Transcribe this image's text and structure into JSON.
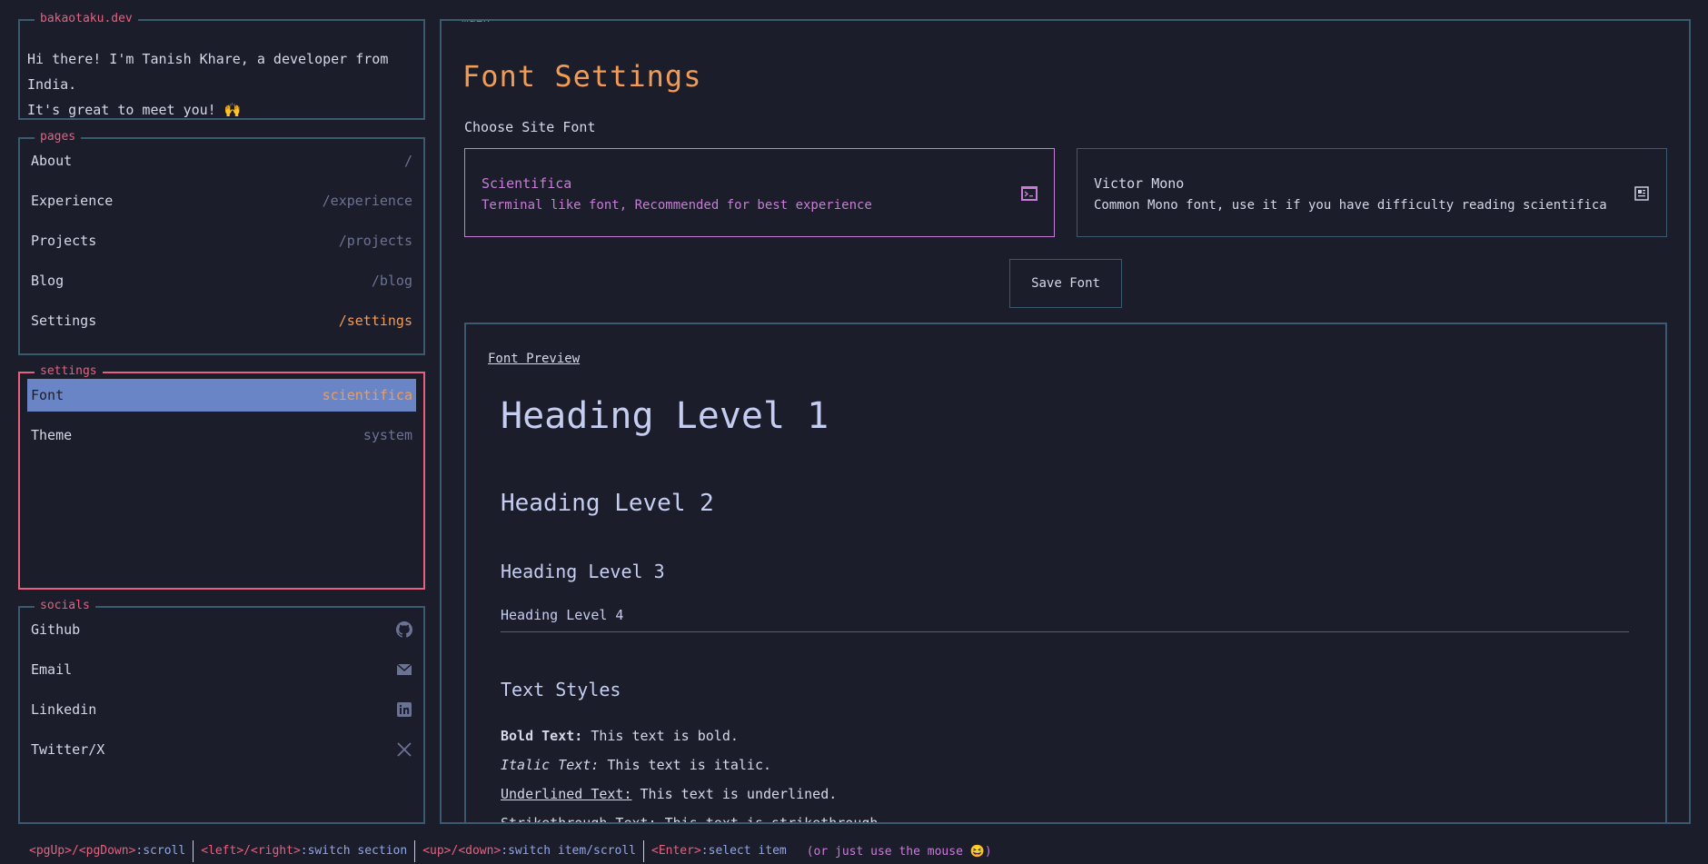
{
  "intro": {
    "title": "bakaotaku.dev",
    "line1": "Hi there! I'm Tanish Khare, a developer from India.",
    "line2": "It's great to meet you! 🙌"
  },
  "pages": {
    "title": "pages",
    "items": [
      {
        "label": "About",
        "path": "/"
      },
      {
        "label": "Experience",
        "path": "/experience"
      },
      {
        "label": "Projects",
        "path": "/projects"
      },
      {
        "label": "Blog",
        "path": "/blog"
      },
      {
        "label": "Settings",
        "path": "/settings"
      }
    ]
  },
  "settings": {
    "title": "settings",
    "items": [
      {
        "label": "Font",
        "value": "scientifica"
      },
      {
        "label": "Theme",
        "value": "system"
      }
    ]
  },
  "socials": {
    "title": "socials",
    "items": [
      {
        "label": "Github",
        "icon": "github-icon"
      },
      {
        "label": "Email",
        "icon": "email-icon"
      },
      {
        "label": "Linkedin",
        "icon": "linkedin-icon"
      },
      {
        "label": "Twitter/X",
        "icon": "x-icon"
      }
    ]
  },
  "main": {
    "panel_title": "main",
    "title": "Font Settings",
    "choose_label": "Choose Site Font",
    "fonts": [
      {
        "name": "Scientifica",
        "desc": "Terminal like font, Recommended for best experience",
        "icon": "terminal-icon"
      },
      {
        "name": "Victor Mono",
        "desc": "Common Mono font, use it if you have difficulty reading scientifica",
        "icon": "document-icon"
      }
    ],
    "save_label": "Save Font",
    "preview": {
      "label": "Font Preview",
      "h1": "Heading Level 1",
      "h2": "Heading Level 2",
      "h3": "Heading Level 3",
      "h4": "Heading Level 4",
      "styles_heading": "Text Styles",
      "bold_key": "Bold Text:",
      "bold_val": " This text is bold.",
      "italic_key": "Italic Text:",
      "italic_val": " This text is italic.",
      "underline_key": "Underlined Text:",
      "underline_val": " This text is underlined.",
      "strike_key": "Strikethrough Text:",
      "strike_val": " This text is strikethrough."
    }
  },
  "footer": {
    "hints": [
      {
        "key": "<pgUp>/<pgDown>",
        "desc": ":scroll"
      },
      {
        "key": "<left>/<right>",
        "desc": ":switch section"
      },
      {
        "key": "<up>/<down>",
        "desc": ":switch item/scroll"
      },
      {
        "key": "<Enter>",
        "desc": ":select item"
      }
    ],
    "note": "(or just use the mouse 😆)"
  },
  "colors": {
    "background": "#1c1d2b",
    "border": "#3a5a6f",
    "accent_pink": "#e8607d",
    "accent_orange": "#f29b55",
    "accent_purple": "#c77dd6",
    "selected_bg": "#6a85c6"
  }
}
